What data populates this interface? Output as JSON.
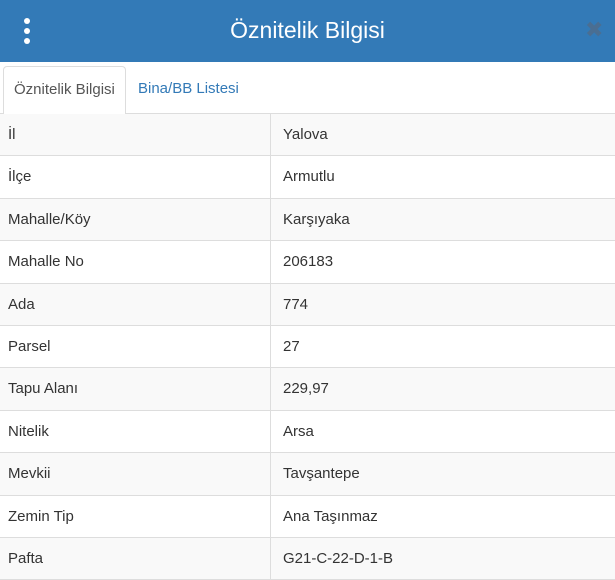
{
  "header": {
    "title": "Öznitelik Bilgisi",
    "menu_icon": "vertical-ellipsis",
    "close_icon": "close-x",
    "accent_color": "#337ab7"
  },
  "tabs": [
    {
      "label": "Öznitelik Bilgisi",
      "active": true
    },
    {
      "label": "Bina/BB Listesi",
      "active": false
    }
  ],
  "attributes": [
    {
      "label": "İl",
      "value": "Yalova"
    },
    {
      "label": "İlçe",
      "value": "Armutlu"
    },
    {
      "label": "Mahalle/Köy",
      "value": "Karşıyaka"
    },
    {
      "label": "Mahalle No",
      "value": "206183"
    },
    {
      "label": "Ada",
      "value": "774"
    },
    {
      "label": "Parsel",
      "value": "27"
    },
    {
      "label": "Tapu Alanı",
      "value": "229,97"
    },
    {
      "label": "Nitelik",
      "value": "Arsa"
    },
    {
      "label": "Mevkii",
      "value": "Tavşantepe"
    },
    {
      "label": "Zemin Tip",
      "value": "Ana Taşınmaz"
    },
    {
      "label": "Pafta",
      "value": "G21-C-22-D-1-B"
    }
  ]
}
